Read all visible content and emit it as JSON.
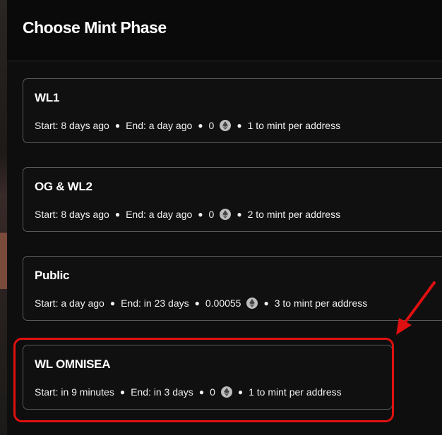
{
  "modal": {
    "title": "Choose Mint Phase"
  },
  "phases": [
    {
      "name": "WL1",
      "start": "Start: 8 days ago",
      "end": "End: a day ago",
      "price": "0",
      "limit": "1 to mint per address"
    },
    {
      "name": "OG & WL2",
      "start": "Start: 8 days ago",
      "end": "End: a day ago",
      "price": "0",
      "limit": "2 to mint per address"
    },
    {
      "name": "Public",
      "start": "Start: a day ago",
      "end": "End: in 23 days",
      "price": "0.00055",
      "limit": "3 to mint per address"
    },
    {
      "name": "WL OMNISEA",
      "start": "Start: in 9 minutes",
      "end": "End: in 3 days",
      "price": "0",
      "limit": "1 to mint per address"
    }
  ],
  "colors": {
    "highlight": "#e01010",
    "currency_icon": "eth-icon"
  }
}
